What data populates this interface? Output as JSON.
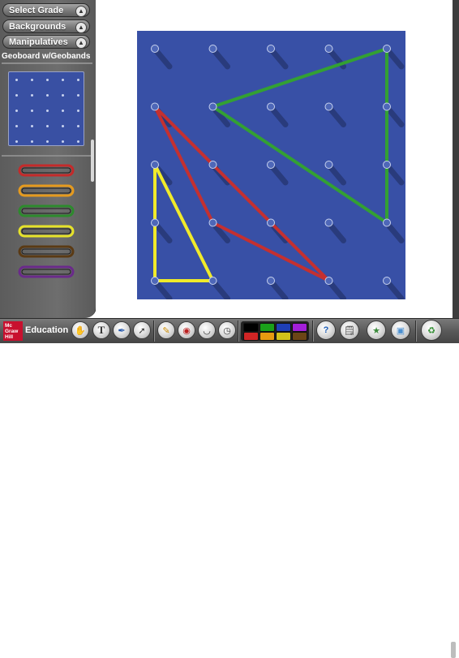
{
  "sidebar": {
    "menus": [
      {
        "label": "Select Grade"
      },
      {
        "label": "Backgrounds"
      },
      {
        "label": "Manipulatives"
      }
    ],
    "section_title": "Geoboard w/Geobands",
    "bands": [
      {
        "color": "#c42a2a"
      },
      {
        "color": "#e59a1e"
      },
      {
        "color": "#2d8a2d"
      },
      {
        "color": "#e6e22a"
      },
      {
        "color": "#5a3a14"
      },
      {
        "color": "#6a2a8a"
      }
    ]
  },
  "geoboard": {
    "background_color": "#3850a6",
    "pegs_per_side": 5,
    "bands": [
      {
        "color": "#33a033",
        "pegs": [
          [
            1,
            1
          ],
          [
            4,
            0
          ],
          [
            4,
            3
          ]
        ]
      },
      {
        "color": "#c43030",
        "pegs": [
          [
            0,
            1
          ],
          [
            1,
            3
          ],
          [
            3,
            4
          ]
        ]
      },
      {
        "color": "#f0ea2a",
        "pegs": [
          [
            0,
            2
          ],
          [
            0,
            4
          ],
          [
            1,
            4
          ]
        ]
      }
    ]
  },
  "toolbar": {
    "logo_text": "Mc Graw Hill",
    "education_label": "Education",
    "tools": [
      {
        "icon": "hand-icon"
      },
      {
        "icon": "text-icon"
      },
      {
        "icon": "pen-icon"
      },
      {
        "icon": "line-icon"
      },
      {
        "icon": "pencil-icon"
      },
      {
        "icon": "stamp-icon"
      },
      {
        "icon": "protractor-icon"
      },
      {
        "icon": "clock-icon"
      }
    ],
    "palette": [
      "#000000",
      "#1aa01a",
      "#1f3fb5",
      "#a21fd8",
      "#d12525",
      "#e69a10",
      "#d2c21a",
      "#6b4516"
    ],
    "right_tools": [
      {
        "icon": "help-icon"
      },
      {
        "icon": "notepad-icon"
      },
      {
        "icon": "puzzle-icon"
      },
      {
        "icon": "screen-icon"
      },
      {
        "icon": "trash-icon"
      }
    ]
  }
}
